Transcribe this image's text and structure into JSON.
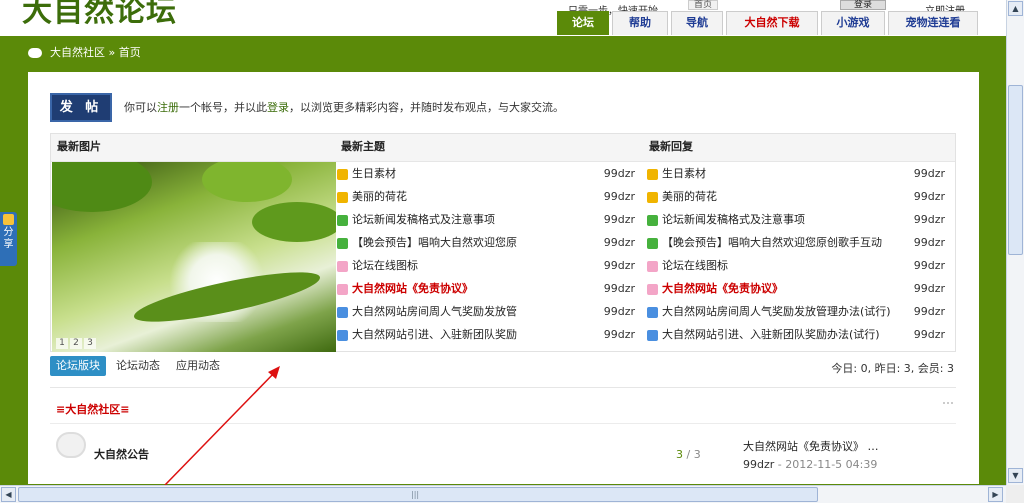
{
  "header": {
    "logo": "大自然论坛",
    "quick_text": "只需一步，快速开始",
    "home": "首页",
    "login_field": "登录",
    "register": "立即注册"
  },
  "nav": [
    {
      "label": "论坛",
      "active": true,
      "red": false
    },
    {
      "label": "帮助",
      "active": false,
      "red": false
    },
    {
      "label": "导航",
      "active": false,
      "red": false
    },
    {
      "label": "大自然下载",
      "active": false,
      "red": true
    },
    {
      "label": "小游戏",
      "active": false,
      "red": false
    },
    {
      "label": "宠物连连看",
      "active": false,
      "red": false
    }
  ],
  "breadcrumb": {
    "site": "大自然社区",
    "sep": "»",
    "page": "首页"
  },
  "share": {
    "label": "分享"
  },
  "post_button": "发 帖",
  "intro": {
    "prefix": "你可以",
    "register": "注册",
    "middle": "一个帐号，并以此",
    "login": "登录",
    "suffix": "，以浏览更多精彩内容，并随时发布观点，与大家交流。"
  },
  "columns": {
    "pics": "最新图片",
    "topics": "最新主题",
    "replies": "最新回复"
  },
  "pager": [
    "1",
    "2",
    "3"
  ],
  "topics": [
    {
      "title": "生日素材",
      "user": "99dzr",
      "hot": false,
      "color": "#f0b400"
    },
    {
      "title": "美丽的荷花",
      "user": "99dzr",
      "hot": false,
      "color": "#f0b400"
    },
    {
      "title": "论坛新闻发稿格式及注意事项",
      "user": "99dzr",
      "hot": false,
      "color": "#46b13d"
    },
    {
      "title": "【晚会预告】唱响大自然欢迎您原",
      "user": "99dzr",
      "hot": false,
      "color": "#46b13d"
    },
    {
      "title": "论坛在线图标",
      "user": "99dzr",
      "hot": false,
      "color": "#f3a5c7"
    },
    {
      "title": "大自然网站《免责协议》",
      "user": "99dzr",
      "hot": true,
      "color": "#f3a5c7"
    },
    {
      "title": "大自然网站房间周人气奖励发放管",
      "user": "99dzr",
      "hot": false,
      "color": "#4a8fe0"
    },
    {
      "title": "大自然网站引进、入驻新团队奖励",
      "user": "99dzr",
      "hot": false,
      "color": "#4a8fe0"
    }
  ],
  "replies": [
    {
      "title": "生日素材",
      "user": "99dzr",
      "hot": false,
      "color": "#f0b400"
    },
    {
      "title": "美丽的荷花",
      "user": "99dzr",
      "hot": false,
      "color": "#f0b400"
    },
    {
      "title": "论坛新闻发稿格式及注意事项",
      "user": "99dzr",
      "hot": false,
      "color": "#46b13d"
    },
    {
      "title": "【晚会预告】唱响大自然欢迎您原创歌手互动",
      "user": "99dzr",
      "hot": false,
      "color": "#46b13d"
    },
    {
      "title": "论坛在线图标",
      "user": "99dzr",
      "hot": false,
      "color": "#f3a5c7"
    },
    {
      "title": "大自然网站《免责协议》",
      "user": "99dzr",
      "hot": true,
      "color": "#f3a5c7"
    },
    {
      "title": "大自然网站房间周人气奖励发放管理办法(试行)",
      "user": "99dzr",
      "hot": false,
      "color": "#4a8fe0"
    },
    {
      "title": "大自然网站引进、入驻新团队奖励办法(试行)",
      "user": "99dzr",
      "hot": false,
      "color": "#4a8fe0"
    }
  ],
  "tabs": [
    {
      "label": "论坛版块",
      "active": true
    },
    {
      "label": "论坛动态",
      "active": false
    },
    {
      "label": "应用动态",
      "active": false
    }
  ],
  "stats": "今日: 0, 昨日: 3, 会员: 3",
  "section": {
    "title": "≡大自然社区≡"
  },
  "forum": {
    "name": "大自然公告",
    "count_a": "3",
    "count_sep": " / ",
    "count_b": "3",
    "last_title": "大自然网站《免责协议》 …",
    "last_user": "99dzr",
    "last_time": " - 2012-11-5 04:39"
  },
  "scroll": {
    "up": "▲",
    "down": "▼",
    "left": "◀",
    "right": "▶",
    "grip": "|||"
  }
}
